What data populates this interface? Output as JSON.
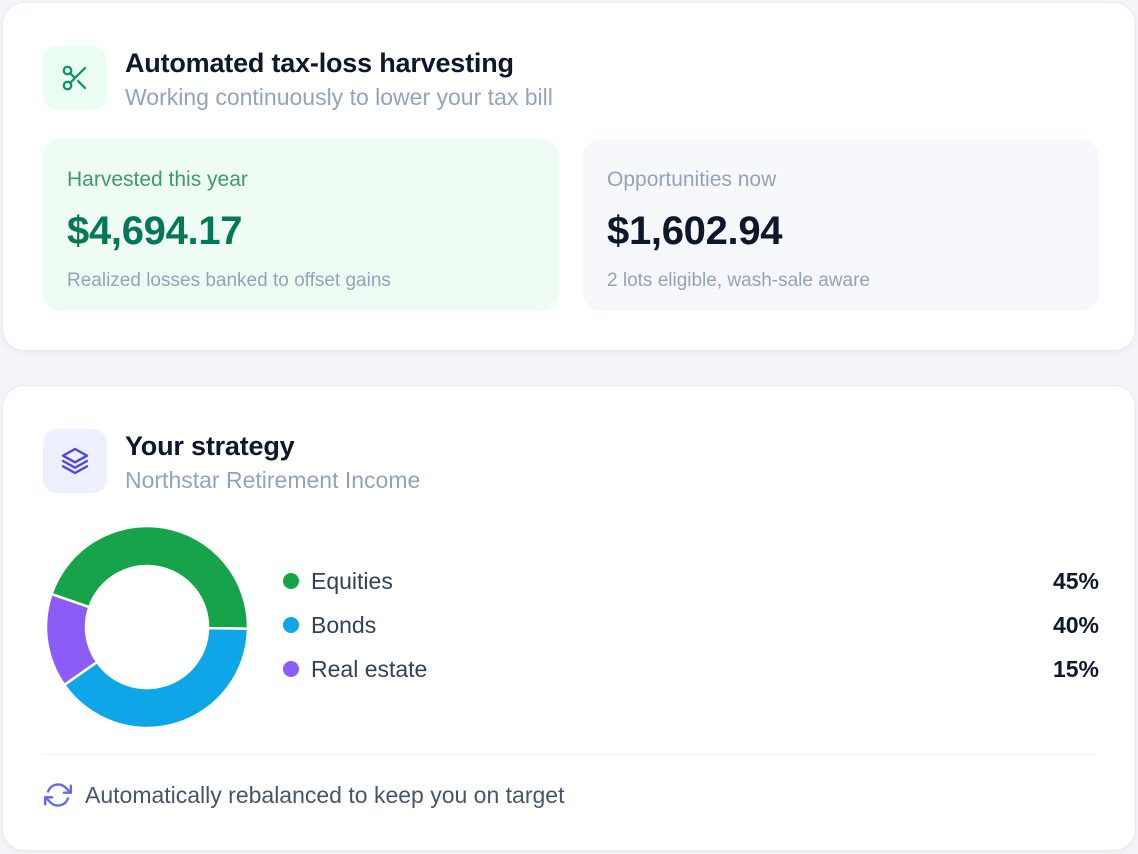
{
  "tax_harvesting": {
    "icon": "scissors-icon",
    "title": "Automated tax-loss harvesting",
    "subtitle": "Working continuously to lower your tax bill",
    "harvested": {
      "label": "Harvested this year",
      "value": "$4,694.17",
      "note": "Realized losses banked to offset gains"
    },
    "opportunities": {
      "label": "Opportunities now",
      "value": "$1,602.94",
      "note": "2 lots eligible, wash-sale aware"
    }
  },
  "strategy": {
    "icon": "layers-icon",
    "title": "Your strategy",
    "subtitle": "Northstar Retirement Income",
    "allocation": [
      {
        "label": "Equities",
        "value": "45%",
        "color": "#16a34a"
      },
      {
        "label": "Bonds",
        "value": "40%",
        "color": "#0ea5e9"
      },
      {
        "label": "Real estate",
        "value": "15%",
        "color": "#8b5cf6"
      }
    ],
    "footer": {
      "icon": "refresh-icon",
      "text": "Automatically rebalanced to keep you on target"
    }
  },
  "chart_data": {
    "type": "pie",
    "categories": [
      "Equities",
      "Bonds",
      "Real estate"
    ],
    "values": [
      45,
      40,
      15
    ],
    "colors": [
      "#16a34a",
      "#0ea5e9",
      "#8b5cf6"
    ],
    "donut": true
  }
}
